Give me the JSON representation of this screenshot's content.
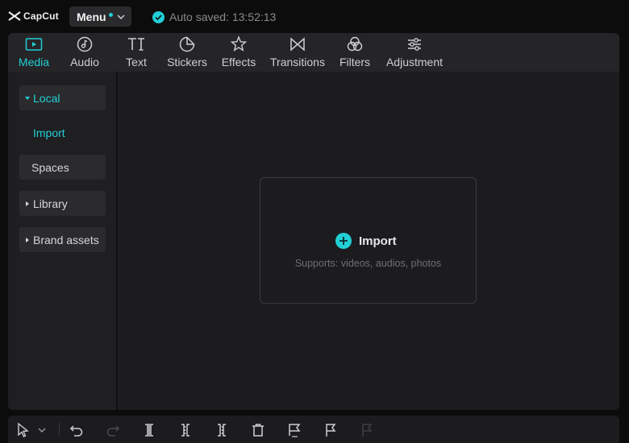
{
  "app": {
    "name": "CapCut"
  },
  "header": {
    "menu_label": "Menu",
    "autosave_text": "Auto saved: 13:52:13",
    "accent_color": "#22cfd6"
  },
  "toolbar": {
    "tabs": [
      {
        "label": "Media",
        "icon": "media-icon",
        "active": true
      },
      {
        "label": "Audio",
        "icon": "audio-icon"
      },
      {
        "label": "Text",
        "icon": "text-icon"
      },
      {
        "label": "Stickers",
        "icon": "stickers-icon"
      },
      {
        "label": "Effects",
        "icon": "effects-icon"
      },
      {
        "label": "Transitions",
        "icon": "transitions-icon"
      },
      {
        "label": "Filters",
        "icon": "filters-icon"
      },
      {
        "label": "Adjustment",
        "icon": "adjustment-icon"
      }
    ]
  },
  "sidebar": {
    "local": "Local",
    "import": "Import",
    "spaces": "Spaces",
    "library": "Library",
    "brand_assets": "Brand assets"
  },
  "dropzone": {
    "import_label": "Import",
    "supports_text": "Supports: videos, audios, photos"
  },
  "bottom_toolbar": {
    "tools": [
      "select-cursor-icon",
      "select-dropdown-icon",
      "undo-icon",
      "redo-icon",
      "split-icon",
      "split-left-icon",
      "split-right-icon",
      "delete-icon",
      "auto-reframe-icon",
      "marker-icon",
      "marker-disabled-icon"
    ]
  }
}
